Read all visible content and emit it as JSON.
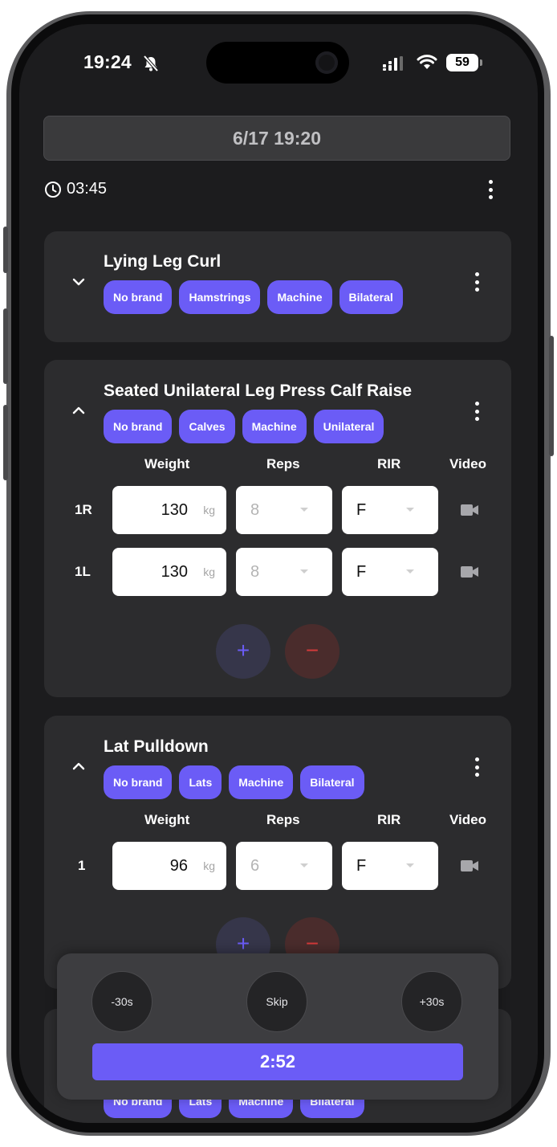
{
  "status_bar": {
    "time": "19:24",
    "battery": "59"
  },
  "workout": {
    "title": "6/17 19:20",
    "elapsed": "03:45"
  },
  "columns": {
    "weight": "Weight",
    "reps": "Reps",
    "rir": "RIR",
    "video": "Video"
  },
  "exercises": [
    {
      "name": "Lying Leg Curl",
      "collapsed": true,
      "tags": [
        "No brand",
        "Hamstrings",
        "Machine",
        "Bilateral"
      ],
      "sets": []
    },
    {
      "name": "Seated Unilateral Leg Press Calf Raise",
      "collapsed": false,
      "tags": [
        "No brand",
        "Calves",
        "Machine",
        "Unilateral"
      ],
      "sets": [
        {
          "label": "1R",
          "weight": "130",
          "unit": "kg",
          "reps": "8",
          "rir": "F"
        },
        {
          "label": "1L",
          "weight": "130",
          "unit": "kg",
          "reps": "8",
          "rir": "F"
        }
      ]
    },
    {
      "name": "Lat Pulldown",
      "collapsed": false,
      "tags": [
        "No brand",
        "Lats",
        "Machine",
        "Bilateral"
      ],
      "sets": [
        {
          "label": "1",
          "weight": "96",
          "unit": "kg",
          "reps": "6",
          "rir": "F"
        }
      ]
    },
    {
      "name": "",
      "collapsed": true,
      "tags": [
        "No brand",
        "Lats",
        "Machine",
        "Bilateral"
      ],
      "sets": []
    }
  ],
  "set_controls": {
    "add": "+",
    "remove": "−"
  },
  "rest_timer": {
    "minus_label": "-30s",
    "skip_label": "Skip",
    "plus_label": "+30s",
    "remaining": "2:52"
  },
  "colors": {
    "accent": "#6b5cf6",
    "card": "#2c2c2e",
    "background": "#1c1c1e",
    "danger": "#d33a3a"
  },
  "icons": {
    "mute": "bell-slash-icon",
    "clock": "clock-icon",
    "more": "kebab-menu-icon",
    "collapse": "chevron-icon",
    "video": "video-camera-icon",
    "signal": "cellular-signal-icon",
    "wifi": "wifi-icon"
  }
}
